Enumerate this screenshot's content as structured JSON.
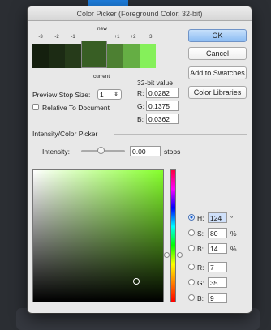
{
  "window": {
    "title": "Color Picker (Foreground Color, 32-bit)"
  },
  "buttons": {
    "ok": "OK",
    "cancel": "Cancel",
    "add_to_swatches": "Add to Swatches",
    "color_libraries": "Color Libraries"
  },
  "preview": {
    "new_label": "new",
    "current_label": "current",
    "stops": [
      "-3",
      "-2",
      "-1",
      "+1",
      "+2",
      "+3"
    ],
    "left_colors": [
      "#15200f",
      "#1c2b14",
      "#263b1a"
    ],
    "current_color": "#385e24",
    "right_colors": [
      "#4d8032",
      "#65ae44",
      "#85f05a"
    ],
    "stop_size_label": "Preview Stop Size:",
    "stop_size_value": "1",
    "relative_label": "Relative To Document"
  },
  "value32": {
    "header": "32-bit value",
    "r_label": "R:",
    "r_value": "0.0282",
    "g_label": "G:",
    "g_value": "0.1375",
    "b_label": "B:",
    "b_value": "0.0362"
  },
  "intensity": {
    "section_label": "Intensity/Color Picker",
    "label": "Intensity:",
    "value": "0.00",
    "unit": "stops"
  },
  "hsb_rgb": {
    "h_label": "H:",
    "h_value": "124",
    "h_unit": "°",
    "s_label": "S:",
    "s_value": "80",
    "s_unit": "%",
    "b_label": "B:",
    "b_value": "14",
    "b_unit": "%",
    "r_label": "R:",
    "r_value": "7",
    "g_label": "G:",
    "g_value": "35",
    "b2_label": "B:",
    "b2_value": "9",
    "selected_mode": "H"
  }
}
